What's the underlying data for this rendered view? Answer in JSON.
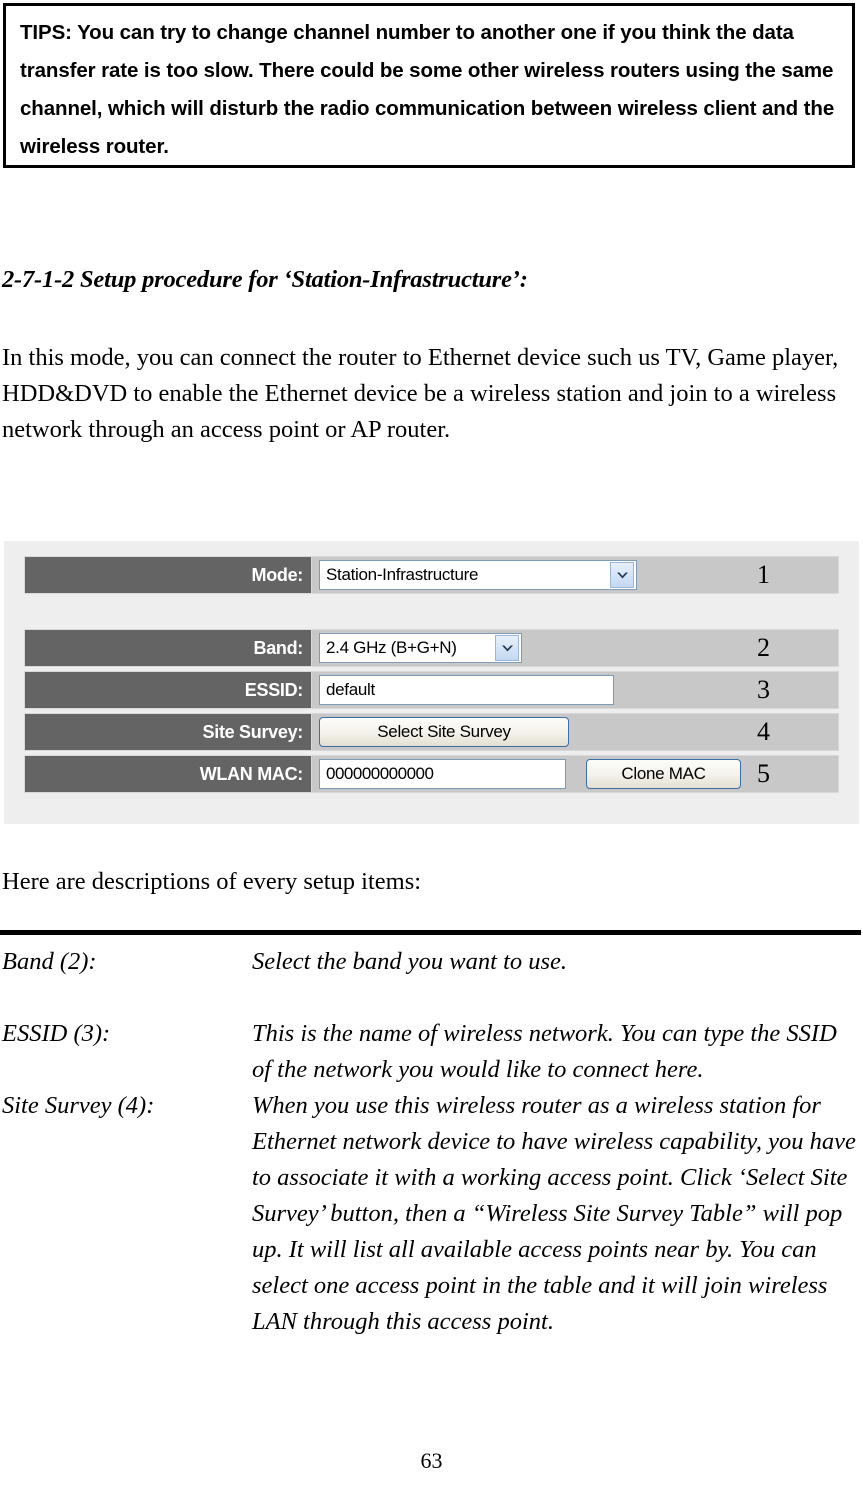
{
  "tips": {
    "name": "TIPS",
    "text": "TIPS: You can try to change channel number to another one if you think the data transfer rate is too slow. There could be some other wireless routers using the same channel, which will disturb the radio communication between wireless client and the wireless router."
  },
  "section": {
    "heading": "2-7-1-2 Setup procedure for ‘Station-Infrastructure’:",
    "intro": "In this mode, you can connect the router to Ethernet device such us TV, Game player, HDD&DVD to enable the Ethernet device be a wireless station and join to a wireless network through an access point or AP router."
  },
  "router_ui": {
    "rows": [
      {
        "label": "Mode:",
        "control": "select",
        "value": "Station-Infrastructure",
        "number": "1"
      },
      {
        "label": "Band:",
        "control": "select",
        "value": "2.4 GHz (B+G+N)",
        "number": "2"
      },
      {
        "label": "ESSID:",
        "control": "input",
        "value": "default",
        "number": "3"
      },
      {
        "label": "Site Survey:",
        "control": "button",
        "value": "Select Site Survey",
        "number": "4"
      },
      {
        "label": "WLAN MAC:",
        "control": "input-button",
        "value": "000000000000",
        "button_label": "Clone MAC",
        "number": "5"
      }
    ]
  },
  "descriptions": {
    "intro": "Here are descriptions of every setup items:",
    "items": [
      {
        "term": "Band (2):",
        "desc": "Select the band you want to use."
      },
      {
        "term": "ESSID (3):",
        "desc": "This is the name of wireless network. You can type the SSID of the network you would like to connect here."
      },
      {
        "term": "Site Survey (4):",
        "desc": "When you use this wireless router as a wireless station for Ethernet network device to have wireless capability, you have to associate it with a working access point. Click ‘Select Site Survey’ button, then a “Wireless Site Survey Table” will pop up. It will list all available access points near by. You can select one access point in the table and it will join wireless LAN through this access point."
      }
    ]
  },
  "footer": {
    "page_number": "63"
  },
  "colors": {
    "label_cell": "#646464",
    "value_cell": "#c8c8c8",
    "figure_background": "#eeeeee",
    "control_border": "#7d9bb5",
    "button_border": "#3a6ea5"
  }
}
